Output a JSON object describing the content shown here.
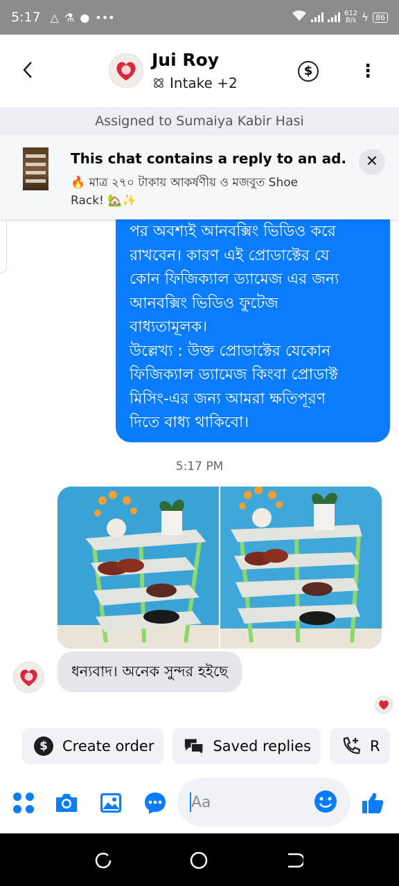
{
  "status_bar": {
    "time": "5:17",
    "net_speed_value": "612",
    "net_speed_unit": "B/s",
    "battery": "86"
  },
  "header": {
    "contact_name": "Jui Roy",
    "subtitle": "Intake +2"
  },
  "assignment": {
    "text": "Assigned to Sumaiya Kabir Hasi"
  },
  "ad_banner": {
    "title": "This chat contains a reply to an ad.",
    "subtitle": "🔥 মাত্র ২৭০ টাকায় আকর্ষণীয় ও মজবুত  Shoe Rack! 🏡✨"
  },
  "messages": {
    "outgoing_text": "পর অবশ্যই আনবক্সিং ভিডিও করে\nরাখবেন। কারণ এই প্রোডাক্টের যে\nকোন ফিজিক্যাল ড্যামেজ এর জন্য\nআনবক্সিং ভিডিও ফুটেজ\nবাধ্যতামূলক।\nউল্লেখ্য : উক্ত প্রোডাক্টের যেকোন\nফিজিক্যাল ড্যামেজ কিংবা প্রোডাক্ট\nমিসিং-এর জন্য আমরা ক্ষতিপূরণ\nদিতে বাধ্য থাকিবো।",
    "timestamp": "5:17 PM",
    "incoming_text": "ধন্যবাদ। অনেক সুন্দর হইছে"
  },
  "quick_replies": [
    {
      "label": "Create order",
      "icon": "dollar-circle-icon"
    },
    {
      "label": "Saved replies",
      "icon": "chat-bubbles-icon"
    },
    {
      "label": "R",
      "icon": "phone-plus-icon"
    }
  ],
  "composer": {
    "placeholder": "Aa"
  },
  "colors": {
    "accent": "#0a7cff",
    "status_bar": "#8c8c8c",
    "incoming_bubble": "#e4e6eb"
  }
}
